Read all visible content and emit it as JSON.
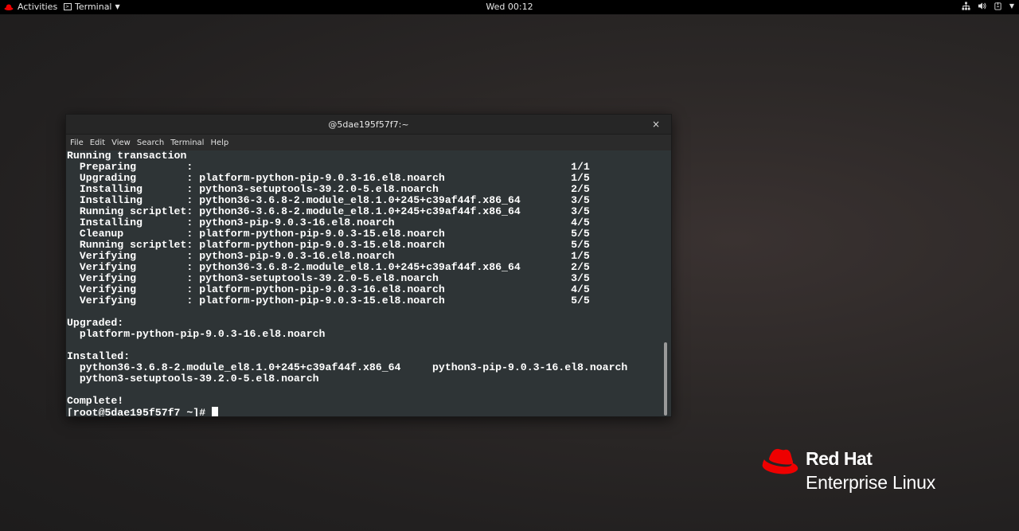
{
  "topbar": {
    "activities_label": "Activities",
    "app_label": "Terminal",
    "clock": "Wed 00:12"
  },
  "window": {
    "title": "@5dae195f57f7:~",
    "close_glyph": "×",
    "menu": [
      "File",
      "Edit",
      "View",
      "Search",
      "Terminal",
      "Help"
    ]
  },
  "terminal": {
    "lines": [
      "Running transaction",
      "  Preparing        :                                                            1/1",
      "  Upgrading        : platform-python-pip-9.0.3-16.el8.noarch                    1/5",
      "  Installing       : python3-setuptools-39.2.0-5.el8.noarch                     2/5",
      "  Installing       : python36-3.6.8-2.module_el8.1.0+245+c39af44f.x86_64        3/5",
      "  Running scriptlet: python36-3.6.8-2.module_el8.1.0+245+c39af44f.x86_64        3/5",
      "  Installing       : python3-pip-9.0.3-16.el8.noarch                            4/5",
      "  Cleanup          : platform-python-pip-9.0.3-15.el8.noarch                    5/5",
      "  Running scriptlet: platform-python-pip-9.0.3-15.el8.noarch                    5/5",
      "  Verifying        : python3-pip-9.0.3-16.el8.noarch                            1/5",
      "  Verifying        : python36-3.6.8-2.module_el8.1.0+245+c39af44f.x86_64        2/5",
      "  Verifying        : python3-setuptools-39.2.0-5.el8.noarch                     3/5",
      "  Verifying        : platform-python-pip-9.0.3-16.el8.noarch                    4/5",
      "  Verifying        : platform-python-pip-9.0.3-15.el8.noarch                    5/5",
      "",
      "Upgraded:",
      "  platform-python-pip-9.0.3-16.el8.noarch",
      "",
      "Installed:",
      "  python36-3.6.8-2.module_el8.1.0+245+c39af44f.x86_64     python3-pip-9.0.3-16.el8.noarch",
      "  python3-setuptools-39.2.0-5.el8.noarch",
      "",
      "Complete!"
    ],
    "prompt": "[root@5dae195f57f7 ~]# "
  },
  "brand": {
    "line1": "Red Hat",
    "line2": "Enterprise Linux",
    "color": "#ee0000"
  },
  "icons": {
    "activities": "redhat-icon",
    "app": "terminal-icon",
    "network": "network-icon",
    "volume": "volume-icon",
    "power": "power-icon"
  }
}
